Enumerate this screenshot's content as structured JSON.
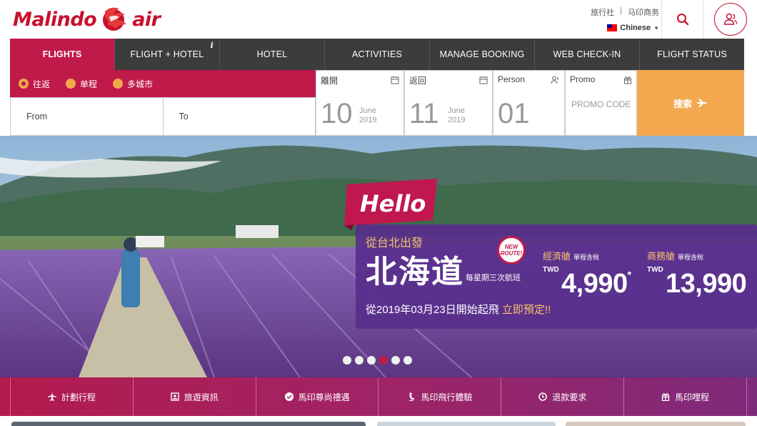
{
  "brand": {
    "name_part1": "Malindo",
    "name_part2": "air",
    "color": "#c8102e"
  },
  "header": {
    "links": [
      "旅行社",
      "|",
      "马印商务"
    ],
    "language": "Chinese",
    "search_icon": "search-icon",
    "account_icon": "users-icon"
  },
  "nav": {
    "items": [
      {
        "label": "FLIGHTS",
        "active": true
      },
      {
        "label": "FLIGHT + HOTEL",
        "info": "i"
      },
      {
        "label": "HOTEL"
      },
      {
        "label": "ACTIVITIES"
      },
      {
        "label": "MANAGE BOOKING"
      },
      {
        "label": "WEB CHECK-IN"
      },
      {
        "label": "FLIGHT STATUS"
      }
    ]
  },
  "search": {
    "trip_types": [
      {
        "label": "往返",
        "selected": true
      },
      {
        "label": "单程",
        "selected": false
      },
      {
        "label": "多城市",
        "selected": false
      }
    ],
    "from_placeholder": "From",
    "to_placeholder": "To",
    "depart": {
      "label": "離開",
      "day": "10",
      "month": "June",
      "year": "2019"
    },
    "return": {
      "label": "返回",
      "day": "11",
      "month": "June",
      "year": "2019"
    },
    "person": {
      "label": "Person",
      "count": "01"
    },
    "promo": {
      "label": "Promo",
      "placeholder": "PROMO CODE"
    },
    "submit_label": "搜索"
  },
  "hero": {
    "banner_word": "Hello",
    "from_text": "從台北出發",
    "destination": "北海道",
    "frequency": "每星期三次航班",
    "new_route": [
      "NEW",
      "ROUTE!"
    ],
    "fares": [
      {
        "class": "經濟艙",
        "tax": "單程含稅",
        "currency": "TWD",
        "amount": "4,990",
        "mark": "*"
      },
      {
        "class": "商務艙",
        "tax": "單程含稅",
        "currency": "TWD",
        "amount": "13,990"
      }
    ],
    "start_text": "從2019年03月23日開始起飛",
    "cta": "立即預定!!",
    "slide_count": 6,
    "active_slide": 4
  },
  "quick_links": [
    {
      "label": "計劃行程",
      "icon": "plane-icon"
    },
    {
      "label": "旅遊資訊",
      "icon": "info-icon"
    },
    {
      "label": "馬印尊尚禮遇",
      "icon": "check-circle-icon"
    },
    {
      "label": "馬印飛行體驗",
      "icon": "seat-icon"
    },
    {
      "label": "退款要求",
      "icon": "refund-icon"
    },
    {
      "label": "馬印哩程",
      "icon": "gift-icon"
    }
  ]
}
